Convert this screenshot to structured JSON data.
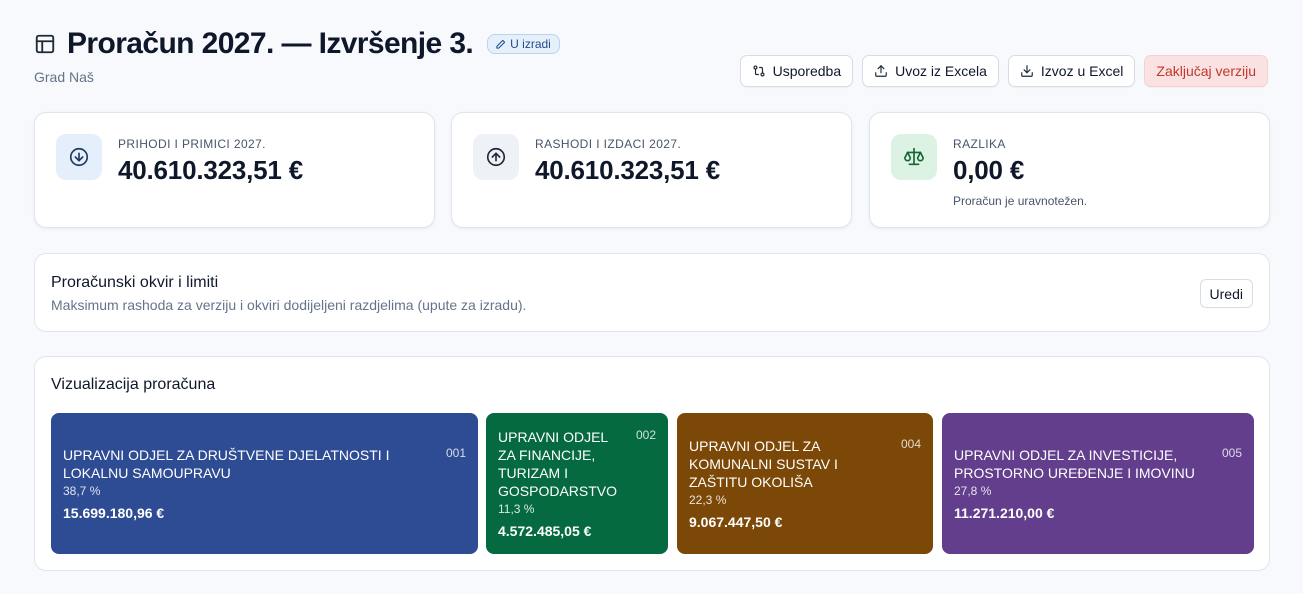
{
  "header": {
    "title": "Proračun 2027. — Izvršenje 3.",
    "status_badge": "U izradi",
    "subtitle": "Grad Naš",
    "actions": {
      "compare": "Usporedba",
      "import": "Uvoz iz Excela",
      "export": "Izvoz u Excel",
      "lock": "Zaključaj verziju"
    }
  },
  "summary": {
    "income": {
      "label": "PRIHODI I PRIMICI 2027.",
      "value": "40.610.323,51 €",
      "icon": "arrow-down-circle-icon"
    },
    "expense": {
      "label": "RASHODI I IZDACI 2027.",
      "value": "40.610.323,51 €",
      "icon": "arrow-up-circle-icon"
    },
    "difference": {
      "label": "RAZLIKA",
      "value": "0,00 €",
      "note": "Proračun je uravnotežen.",
      "icon": "scale-icon"
    }
  },
  "framework": {
    "title": "Proračunski okvir i limiti",
    "description": "Maksimum rashoda za verziju i okviri dodijeljeni razdjelima (upute za izradu).",
    "edit_label": "Uredi"
  },
  "visualization": {
    "title": "Vizualizacija proračuna",
    "tiles": [
      {
        "code": "001",
        "name": "UPRAVNI ODJEL ZA DRUŠTVENE DJELATNOSTI I LOKALNU SAMOUPRAVU",
        "percent": "38,7 %",
        "amount": "15.699.180,96 €",
        "color": "#2e4c93"
      },
      {
        "code": "002",
        "name": "UPRAVNI ODJEL ZA FINANCIJE, TURIZAM I GOSPODARSTVO",
        "percent": "11,3 %",
        "amount": "4.572.485,05 €",
        "color": "#056a3f"
      },
      {
        "code": "004",
        "name": "UPRAVNI ODJEL ZA KOMUNALNI SUSTAV I ZAŠTITU OKOLIŠA",
        "percent": "22,3 %",
        "amount": "9.067.447,50 €",
        "color": "#7b4807"
      },
      {
        "code": "005",
        "name": "UPRAVNI ODJEL ZA INVESTICIJE, PROSTORNO UREĐENJE I IMOVINU",
        "percent": "27,8 %",
        "amount": "11.271.210,00 €",
        "color": "#623e8c"
      }
    ]
  }
}
